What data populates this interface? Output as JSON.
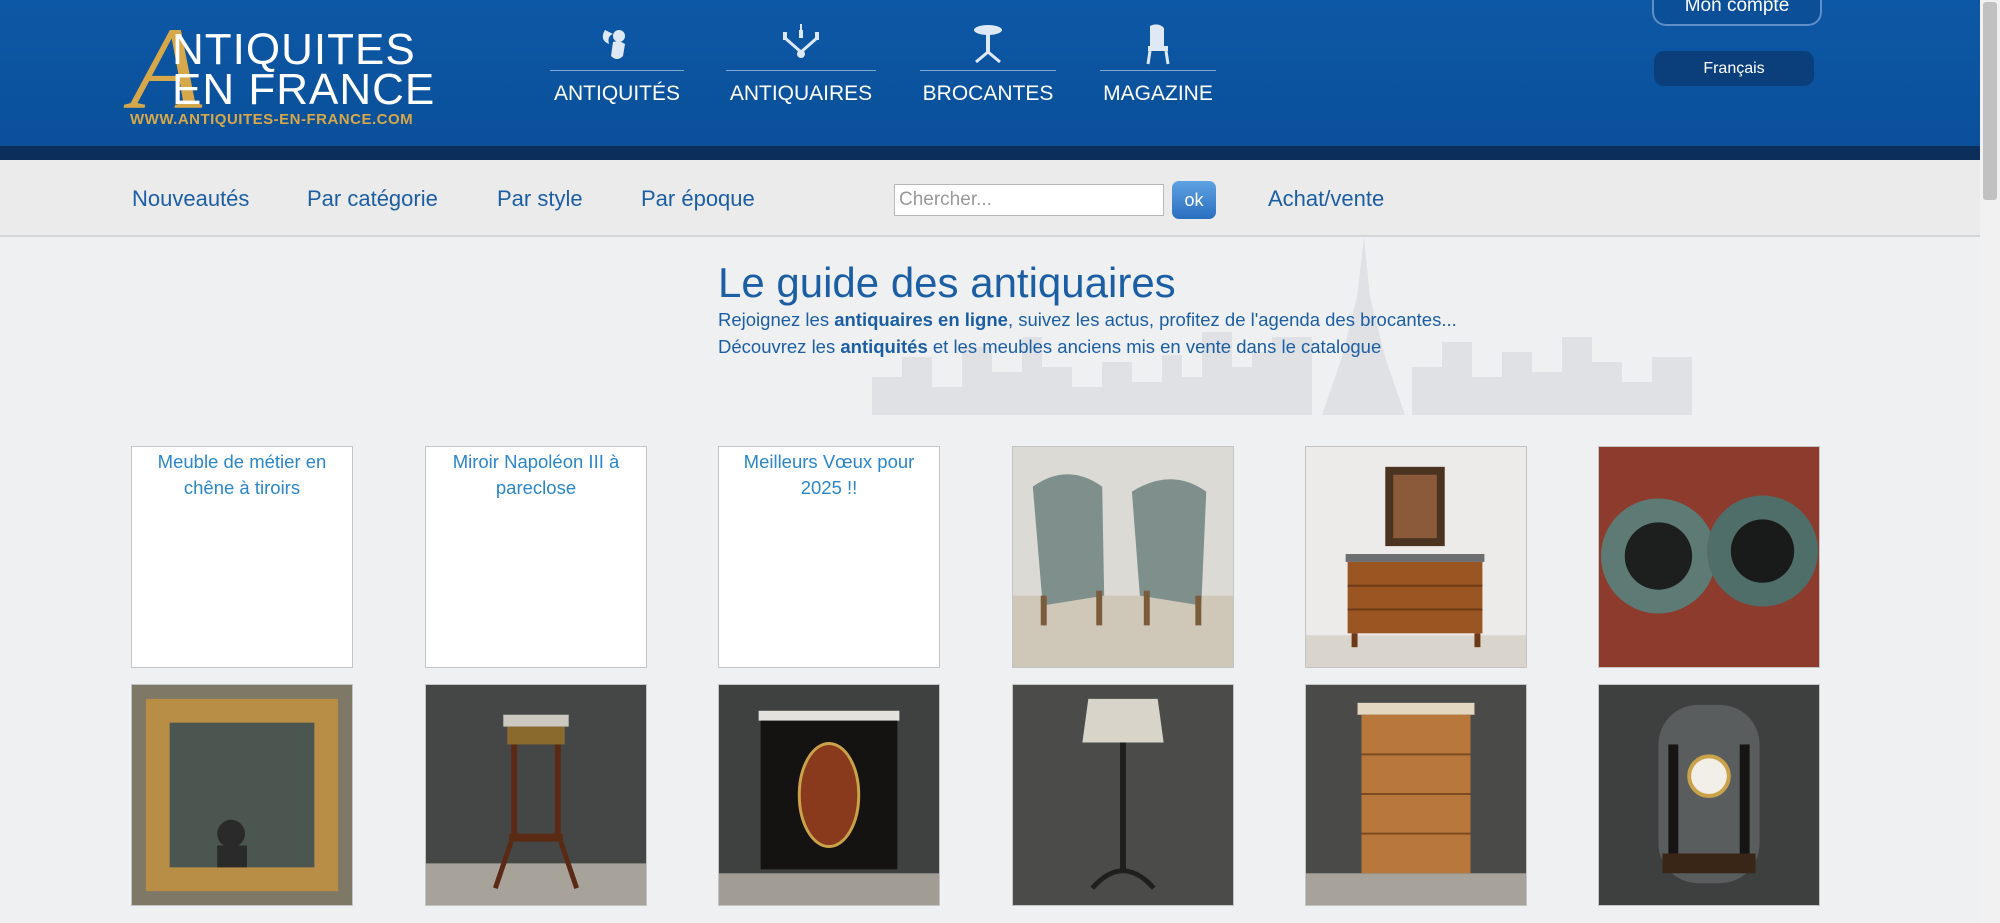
{
  "header": {
    "logo_line1": "NTIQUITES",
    "logo_big_letter": "A",
    "logo_line2": "EN FRANCE",
    "logo_url": "WWW.ANTIQUITES-EN-FRANCE.COM",
    "nav": [
      {
        "label": "ANTIQUITÉS",
        "icon": "cherub-icon"
      },
      {
        "label": "ANTIQUAIRES",
        "icon": "chandelier-icon"
      },
      {
        "label": "BROCANTES",
        "icon": "pedestal-table-icon"
      },
      {
        "label": "MAGAZINE",
        "icon": "chair-icon"
      }
    ],
    "account_label": "Mon compte",
    "language_label": "Français"
  },
  "subnav": {
    "links": [
      "Nouveautés",
      "Par catégorie",
      "Par style",
      "Par époque"
    ],
    "search_placeholder": "Chercher...",
    "search_button": "ok",
    "buy_sell": "Achat/vente"
  },
  "guide": {
    "title": "Le guide des antiquaires",
    "line1_a": "Rejoignez les ",
    "line1_b": "antiquaires en ligne",
    "line1_c": ", suivez les actus, profitez de l'agenda des brocantes...",
    "line2_a": "Découvrez les ",
    "line2_b": "antiquités",
    "line2_c": " et les meubles anciens mis en vente dans le catalogue"
  },
  "products": [
    {
      "alt": "Meuble de métier en chêne à tiroirs",
      "image": "broken"
    },
    {
      "alt": "Miroir Napoléon III à pareclose",
      "image": "broken"
    },
    {
      "alt": "Meilleurs Vœux pour 2025 !!",
      "image": "broken"
    },
    {
      "alt": "",
      "image": "pair-of-armchairs"
    },
    {
      "alt": "",
      "image": "marble-top-commode"
    },
    {
      "alt": "",
      "image": "gramophone-horns"
    },
    {
      "alt": "",
      "image": "gilded-mirror"
    },
    {
      "alt": "",
      "image": "marble-pedestal"
    },
    {
      "alt": "",
      "image": "boulle-cabinet"
    },
    {
      "alt": "",
      "image": "floor-lamp"
    },
    {
      "alt": "",
      "image": "chest-of-drawers"
    },
    {
      "alt": "",
      "image": "portico-clock"
    }
  ],
  "colors": {
    "header_blue": "#0a4f98",
    "gold": "#d7a84a",
    "link_blue": "#1c5ea3"
  }
}
